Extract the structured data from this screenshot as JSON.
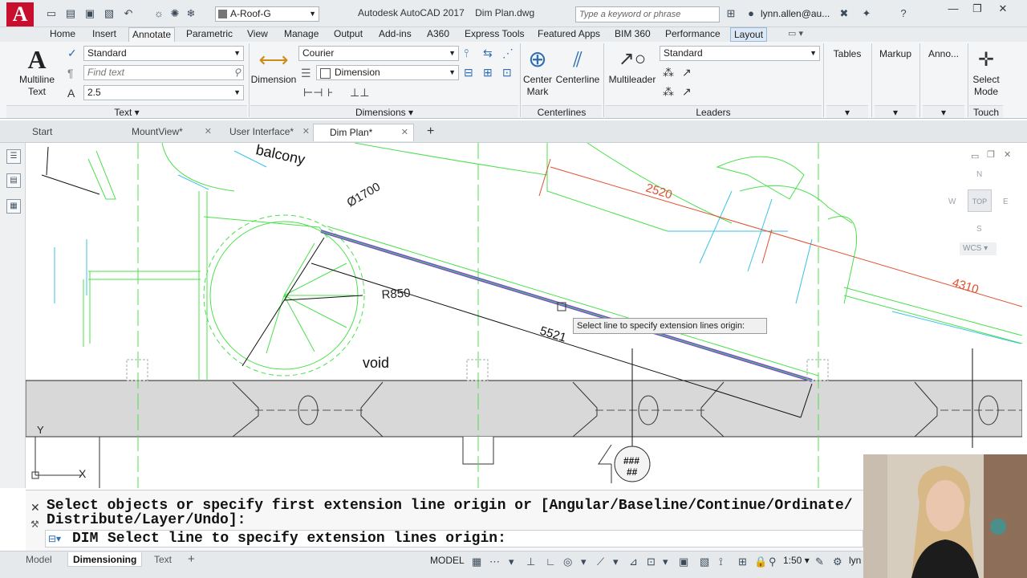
{
  "app": {
    "logo_letter": "A",
    "title": "Autodesk AutoCAD 2017",
    "file": "Dim Plan.dwg",
    "search_placeholder": "Type a keyword or phrase",
    "user": "lynn.allen@au...",
    "layer": "A-Roof-G"
  },
  "ribbon_tabs": [
    "Home",
    "Insert",
    "Annotate",
    "Parametric",
    "View",
    "Manage",
    "Output",
    "Add-ins",
    "A360",
    "Express Tools",
    "Featured Apps",
    "BIM 360",
    "Performance",
    "Layout"
  ],
  "text_panel": {
    "title": "Text",
    "multiline_label1": "Multiline",
    "multiline_label2": "Text",
    "style": "Standard",
    "find_placeholder": "Find text",
    "height": "2.5"
  },
  "dimensions_panel": {
    "title": "Dimensions",
    "dimension_label": "Dimension",
    "font": "Courier",
    "dimstyle": "Dimension"
  },
  "centerlines_panel": {
    "title": "Centerlines",
    "center_mark1": "Center",
    "center_mark2": "Mark",
    "centerline": "Centerline"
  },
  "leaders_panel": {
    "title": "Leaders",
    "multileader": "Multileader",
    "style": "Standard"
  },
  "right_buttons": {
    "tables": "Tables",
    "markup": "Markup",
    "anno": "Anno...",
    "select1": "Select",
    "select2": "Mode",
    "touch": "Touch"
  },
  "doc_tabs": [
    "Start",
    "MountView*",
    "User Interface*",
    "Dim Plan*"
  ],
  "drawing": {
    "balcony": "balcony",
    "diameter": "Ø1700",
    "radius": "R850",
    "void": "void",
    "dim_5521": "5521",
    "dim_2520": "2520",
    "dim_4310": "4310",
    "tag": "###",
    "tag2": "##",
    "axis_y": "Y",
    "axis_x": "X",
    "tooltip": "Select line to specify extension lines origin:"
  },
  "viewcube": {
    "north": "N",
    "west": "W",
    "east": "E",
    "south": "S",
    "top": "TOP",
    "wcs": "WCS"
  },
  "command": {
    "line1": "Select objects or specify first extension line origin or [Angular/Baseline/Continue/Ordinate/",
    "line2": "Distribute/Layer/Undo]:",
    "prompt_cmd": "DIM",
    "prompt": "Select line to specify extension lines origin:"
  },
  "status": {
    "tabs": [
      "Model",
      "Dimensioning",
      "Text"
    ],
    "space": "MODEL",
    "scale": "1:50",
    "user_short": "lyn"
  },
  "colors": {
    "accent_red": "#c8102e",
    "draw_green": "#4be04b",
    "draw_cyan": "#39c3e6",
    "dim_red": "#e05030"
  }
}
